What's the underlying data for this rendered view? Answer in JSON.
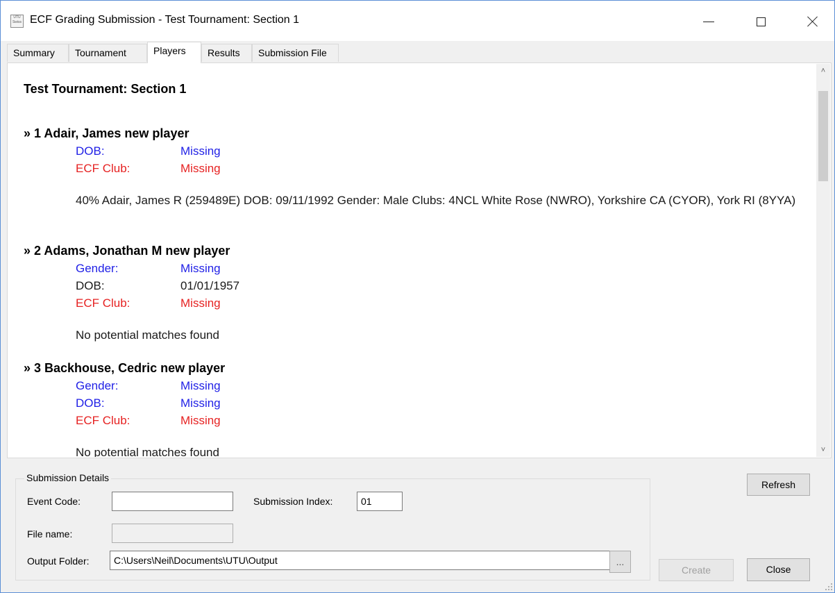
{
  "window": {
    "title": "ECF Grading Submission - Test Tournament: Section 1",
    "icon_text": "UTU Swiss"
  },
  "tabs": [
    {
      "label": "Summary"
    },
    {
      "label": "Tournament"
    },
    {
      "label": "Players"
    },
    {
      "label": "Results"
    },
    {
      "label": "Submission File"
    }
  ],
  "active_tab": "Players",
  "report": {
    "title": "Test Tournament: Section 1",
    "players": [
      {
        "heading": "» 1 Adair, James new player",
        "fields": [
          {
            "label": "DOB:",
            "value": "Missing"
          },
          {
            "label": "ECF Club:",
            "value": "Missing"
          }
        ],
        "match": "40% Adair, James R (259489E)   DOB: 09/11/1992   Gender: Male   Clubs: 4NCL White Rose (NWRO), Yorkshire CA (CYOR), York RI (8YYA)"
      },
      {
        "heading": "» 2 Adams, Jonathan M new player",
        "fields": [
          {
            "label": "Gender:",
            "value": "Missing"
          },
          {
            "label": "DOB:",
            "value": "01/01/1957"
          },
          {
            "label": "ECF Club:",
            "value": "Missing"
          }
        ],
        "match": "No potential matches found"
      },
      {
        "heading": "» 3 Backhouse, Cedric new player",
        "fields": [
          {
            "label": "Gender:",
            "value": "Missing"
          },
          {
            "label": "DOB:",
            "value": "Missing"
          },
          {
            "label": "ECF Club:",
            "value": "Missing"
          }
        ],
        "match": "No potential matches found"
      }
    ]
  },
  "colors": {
    "missing_blue": "#1f1fe6",
    "missing_red": "#e62222"
  },
  "submission": {
    "group_label": "Submission Details",
    "event_code_label": "Event Code:",
    "event_code_value": "",
    "submission_index_label": "Submission Index:",
    "submission_index_value": "01",
    "file_name_label": "File name:",
    "file_name_value": "",
    "output_folder_label": "Output Folder:",
    "output_folder_value": "C:\\Users\\Neil\\Documents\\UTU\\Output",
    "browse_label": "..."
  },
  "buttons": {
    "refresh": "Refresh",
    "create": "Create",
    "close": "Close"
  }
}
